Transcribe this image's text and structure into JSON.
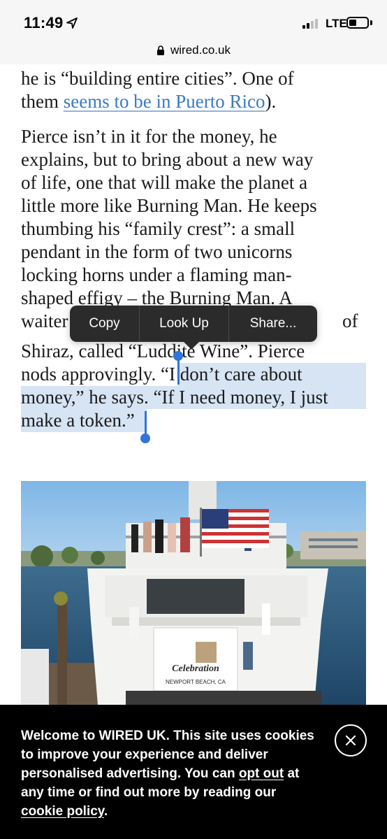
{
  "status_bar": {
    "time": "11:49",
    "network": "LTE",
    "icons": [
      "location-arrow-icon",
      "cell-signal-icon",
      "battery-icon"
    ]
  },
  "browser": {
    "url": "wired.co.uk",
    "lock_icon": "lock-icon"
  },
  "article": {
    "line1": "he is “building entire cities”. One of",
    "line2_before": "them ",
    "line2_link": "seems to be in Puerto Rico",
    "line2_after": ").",
    "p2_line1": "Pierce isn’t in it for the money, he",
    "p2_line2": "explains, but to bring about a new way",
    "p2_line3": "of life, one that will make the planet a",
    "p2_line4": "little more like Burning Man. He keeps",
    "p2_line5": "thumbing his “family crest”: a small",
    "p2_line6": "pendant in the form of two unicorns",
    "p2_line7": "locking horns under a flaming man-",
    "p2_line8": "shaped effigy – the Burning Man. A",
    "p2_line9_left": "waiter",
    "p2_line9_right": "of",
    "p2_line10": "Shiraz, called “Luddite Wine”. Pierce",
    "p2_line11_before": "nods approvingly. ",
    "p2_line11_selected": "“I don’t care about",
    "p2_line12": "money,” he says. “If I need money, I just",
    "p2_line13": "make a token.”"
  },
  "callout_menu": {
    "items": [
      "Copy",
      "Look Up",
      "Share..."
    ]
  },
  "cookie_banner": {
    "text_1": "Welcome to WIRED UK. This site uses cookies to improve your experience and deliver personalised advertising. You can ",
    "opt_out": "opt out",
    "text_2": " at any time or find out more by reading our ",
    "cookie_policy": "cookie policy",
    "text_3": ".",
    "close_icon": "close-icon"
  },
  "photo": {
    "boat_name": "Celebration",
    "boat_port": "NEWPORT BEACH, CA"
  },
  "colors": {
    "link": "#3a7ac0",
    "selection": "#d6e4f4",
    "handle": "#2f76d8",
    "callout_bg": "#2b2b2b",
    "banner_bg": "#000000"
  }
}
